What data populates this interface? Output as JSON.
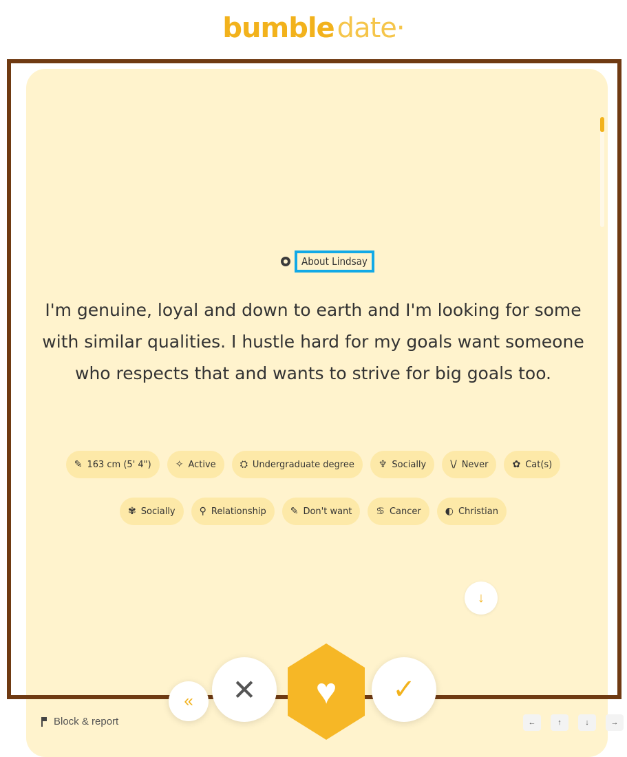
{
  "brand": {
    "bold": "bumble",
    "light": "date",
    "dot": "·"
  },
  "profile": {
    "about_label": "About Lindsay",
    "bio": "I'm genuine, loyal and down to earth and I'm looking for some with similar qualities. I hustle hard for my goals want someone who respects that and wants to strive for big goals too.",
    "badges_row1": [
      {
        "icon": "ruler-icon",
        "glyph": "✎",
        "label": "163 cm (5' 4\")"
      },
      {
        "icon": "exercise-icon",
        "glyph": "✧",
        "label": "Active"
      },
      {
        "icon": "graduation-cap-icon",
        "glyph": "⛭",
        "label": "Undergraduate degree"
      },
      {
        "icon": "drink-icon",
        "glyph": "♆",
        "label": "Socially"
      },
      {
        "icon": "smoking-icon",
        "glyph": "\\/",
        "label": "Never"
      },
      {
        "icon": "pet-paw-icon",
        "glyph": "✿",
        "label": "Cat(s)"
      }
    ],
    "badges_row2": [
      {
        "icon": "cannabis-icon",
        "glyph": "✾",
        "label": "Socially"
      },
      {
        "icon": "search-icon",
        "glyph": "⚲",
        "label": "Relationship"
      },
      {
        "icon": "kids-icon",
        "glyph": "✎",
        "label": "Don't want"
      },
      {
        "icon": "zodiac-icon",
        "glyph": "♋",
        "label": "Cancer"
      },
      {
        "icon": "religion-icon",
        "glyph": "◐",
        "label": "Christian"
      }
    ]
  },
  "actions": {
    "rewind_icon": "«",
    "pass_icon": "✕",
    "superswipe_icon": "♥",
    "like_icon": "✓",
    "scroll_down_icon": "↓"
  },
  "footer": {
    "block_report": "Block & report",
    "nav_keys": [
      "←",
      "↑",
      "↓",
      "→"
    ]
  },
  "colors": {
    "accent": "#f2b21c",
    "card": "#fff3cd",
    "chip": "#fde9a8",
    "frame": "#6f3a12",
    "highlight": "#12a9e6"
  }
}
